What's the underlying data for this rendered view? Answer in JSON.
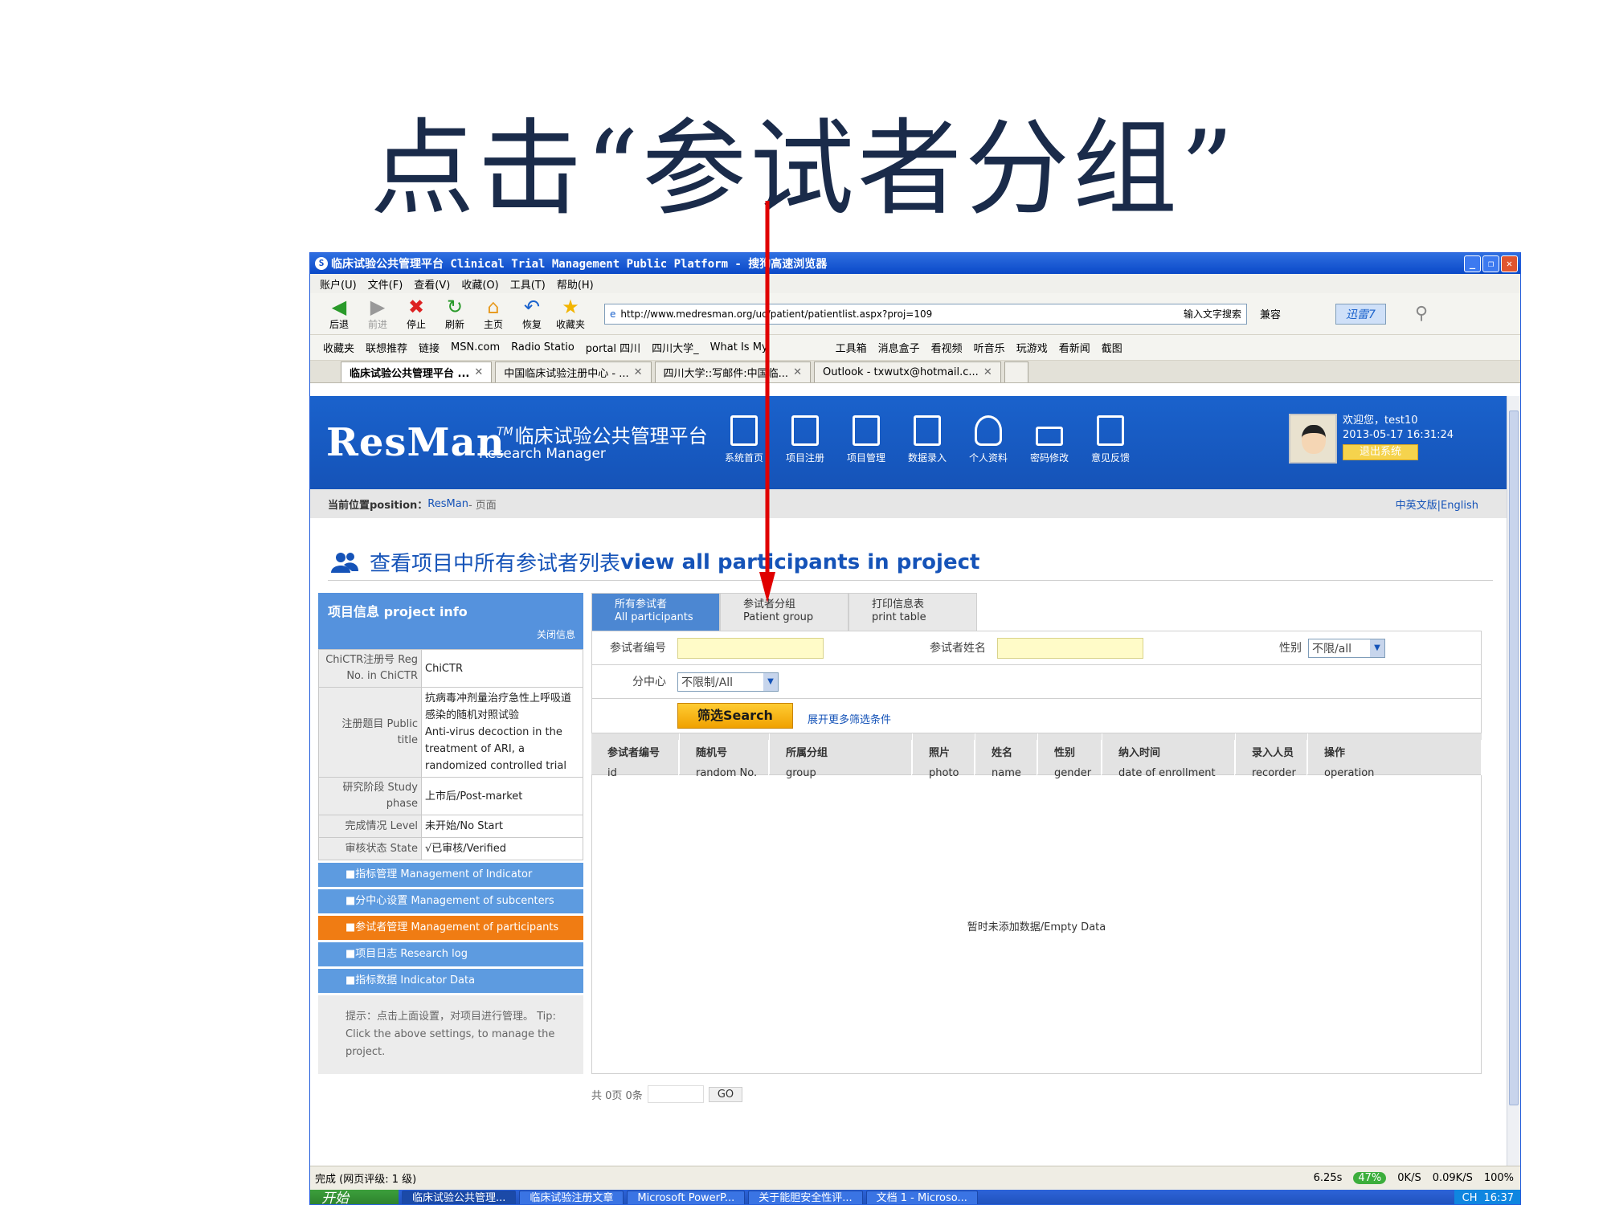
{
  "slide": {
    "title": "点击“参试者分组”"
  },
  "browser": {
    "title": "临床试验公共管理平台 Clinical Trial Management Public Platform - 搜狗高速浏览器",
    "menu": [
      "账户(U)",
      "文件(F)",
      "查看(V)",
      "收藏(O)",
      "工具(T)",
      "帮助(H)"
    ],
    "toolbar": [
      "后退",
      "前进",
      "停止",
      "刷新",
      "主页",
      "恢复",
      "收藏夹"
    ],
    "url": "http://www.medresman.org/uc/patient/patientlist.aspx?proj=109",
    "search_hint": "输入文字搜索",
    "compat": "兼容",
    "xunlei": "迅雷7",
    "favorites": [
      "收藏夹",
      "联想推荐",
      "链接",
      "MSN.com",
      "Radio Statio",
      "portal 四川",
      "四川大学_",
      "What Is My",
      "工具箱",
      "消息盒子",
      "看视频",
      "听音乐",
      "玩游戏",
      "看新闻",
      "截图"
    ],
    "tabs": [
      "临床试验公共管理平台 ...",
      "中国临床试验注册中心 - ...",
      "四川大学::写邮件:中国临...",
      "Outlook - txwutx@hotmail.c..."
    ],
    "status": "完成 (网页评级: 1 级)",
    "status_right": [
      "6.25s",
      "47%",
      "0K/S",
      "0.09K/S",
      "100%"
    ]
  },
  "taskbar": {
    "start": "开始",
    "tasks": [
      "临床试验公共管理...",
      "临床试验注册文章",
      "Microsoft PowerP...",
      "关于能胆安全性评...",
      "文档 1 - Microso..."
    ],
    "tray": [
      "CH",
      "16:37"
    ]
  },
  "site": {
    "logo": "ResMan",
    "logo_tm": "TM",
    "logo_cn": "临床试验公共管理平台",
    "logo_en": "Research Manager",
    "nav": [
      "系统首页",
      "项目注册",
      "项目管理",
      "数据录入",
      "个人资料",
      "密码修改",
      "意见反馈"
    ],
    "welcome": "欢迎您，test10",
    "datetime": "2013-05-17 16:31:24",
    "logout": "退出系统",
    "breadcrumb_label": "当前位置position：",
    "breadcrumb_link": "ResMan",
    "breadcrumb_rest": " - 页面",
    "lang": "中英文版|English",
    "page_title_cn": "查看项目中所有参试者列表",
    "page_title_en": "view all participants in project"
  },
  "project_info": {
    "header": "项目信息  project info",
    "close": "关闭信息",
    "rows": [
      {
        "k": "ChiCTR注册号 Reg No. in ChiCTR",
        "v": "ChiCTR"
      },
      {
        "k": "注册题目 Public title",
        "v_cn": "抗病毒冲剂量治疗急性上呼吸道感染的随机对照试验",
        "v_en": "Anti-virus decoction in the treatment of ARI, a randomized controlled trial"
      },
      {
        "k": "研究阶段 Study phase",
        "v": "上市后/Post-market"
      },
      {
        "k": "完成情况 Level",
        "v": "未开始/No Start"
      },
      {
        "k": "审核状态 State",
        "v": "√已审核/Verified"
      }
    ]
  },
  "left_menu": [
    "■指标管理  Management of Indicator",
    "■分中心设置  Management of subcenters",
    "■参试者管理  Management of participants",
    "■项目日志  Research log",
    "■指标数据  Indicator Data"
  ],
  "tip": "提示：点击上面设置，对项目进行管理。 Tip: Click the above settings, to manage the project.",
  "panel_tabs": [
    {
      "cn": "所有参试者",
      "en": "All participants"
    },
    {
      "cn": "参试者分组",
      "en": "Patient group"
    },
    {
      "cn": "打印信息表",
      "en": "print table"
    }
  ],
  "filters": {
    "id_label": "参试者编号",
    "name_label": "参试者姓名",
    "gender_label": "性别",
    "gender_value": "不限/all",
    "center_label": "分中心",
    "center_value": "不限制/All",
    "search_btn": "筛选Search",
    "more": "展开更多筛选条件"
  },
  "table": {
    "headers": [
      {
        "cn": "参试者编号",
        "en": "id"
      },
      {
        "cn": "随机号",
        "en": "random No."
      },
      {
        "cn": "所属分组",
        "en": "group"
      },
      {
        "cn": "照片",
        "en": "photo"
      },
      {
        "cn": "姓名",
        "en": "name"
      },
      {
        "cn": "性别",
        "en": "gender"
      },
      {
        "cn": "纳入时间",
        "en": "date of enrollment"
      },
      {
        "cn": "录入人员",
        "en": "recorder"
      },
      {
        "cn": "操作",
        "en": "operation"
      }
    ],
    "empty": "暂时未添加数据/Empty Data"
  },
  "pager": {
    "text": "共 0页 0条",
    "go": "GO"
  },
  "colors": {
    "accent": "#1553b8",
    "arrow": "#e00000",
    "active_menu": "#f07c13"
  }
}
